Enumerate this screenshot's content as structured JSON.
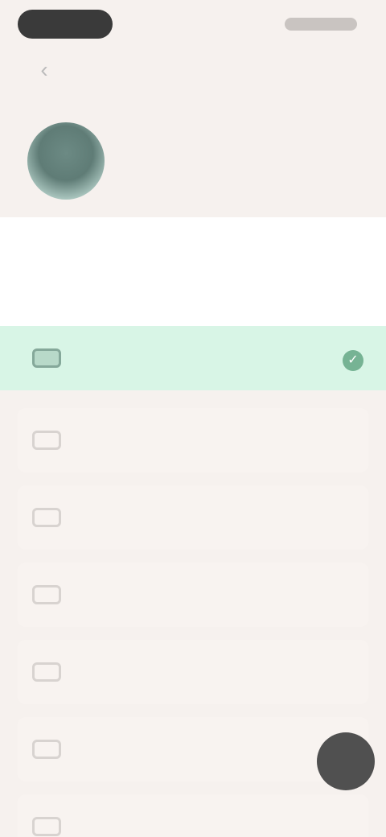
{
  "status_bar": {
    "left_pill": "",
    "right_icons": ""
  },
  "header": {
    "back_icon": "back-arrow-icon",
    "title": ""
  },
  "profile": {
    "avatar": "avatar-image",
    "name": ""
  },
  "question": {
    "text": ""
  },
  "options": [
    {
      "label": "",
      "icon": "option-icon",
      "selected": true
    },
    {
      "label": "",
      "icon": "option-icon",
      "selected": false
    },
    {
      "label": "",
      "icon": "option-icon",
      "selected": false
    },
    {
      "label": "",
      "icon": "option-icon",
      "selected": false
    },
    {
      "label": "",
      "icon": "option-icon",
      "selected": false
    },
    {
      "label": "",
      "icon": "option-icon",
      "selected": false
    },
    {
      "label": "",
      "icon": "option-icon",
      "selected": false
    }
  ],
  "fab": {
    "icon": "action-icon",
    "color": "#505050"
  },
  "colors": {
    "selected_bg": "#d8f5e6",
    "accent": "#76b394",
    "page_bg": "#f6f1ee"
  }
}
